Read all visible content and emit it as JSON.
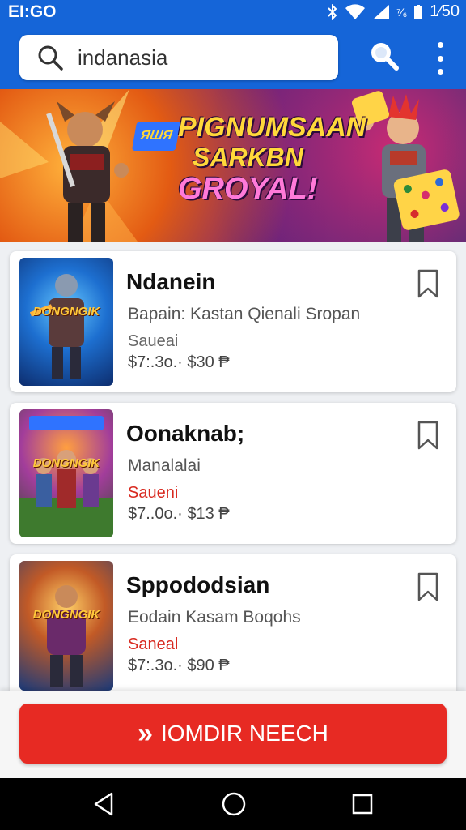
{
  "status_bar": {
    "time": "EI:GO",
    "battery": "1⁄50",
    "signal_text": "⁷⁄₆"
  },
  "search": {
    "value": "indanasia",
    "placeholder": ""
  },
  "banner": {
    "tag": "ЯШЯ",
    "line1": "PIGNUMSAAN",
    "line2": "SARKBN",
    "line3": "GROYAL!"
  },
  "listings": [
    {
      "title": "Ndanein",
      "subtitle": "Bapain: Kastan Qienali Sropan",
      "line3": "Saueai",
      "line3_highlight": false,
      "price": "$7:.3o.· $30 ₱",
      "thumb_label": "DONGNGIK"
    },
    {
      "title": "Oonaknab;",
      "subtitle": "Manalalai",
      "line3": "Saueni",
      "line3_highlight": true,
      "price": "$7..0o.· $13 ₱",
      "thumb_label": "DONGNGIK"
    },
    {
      "title": "Sppododsian",
      "subtitle": "Eodain Kasam Boqohs",
      "line3": "Saneal",
      "line3_highlight": true,
      "price": "$7:.3o.· $90 ₱",
      "thumb_label": "DONGNGIK"
    }
  ],
  "cta": {
    "icon": "»",
    "label": "IOMDIR NEECH"
  },
  "colors": {
    "primary": "#1565d8",
    "accent": "#e72a23",
    "highlight_text": "#d8291f"
  }
}
